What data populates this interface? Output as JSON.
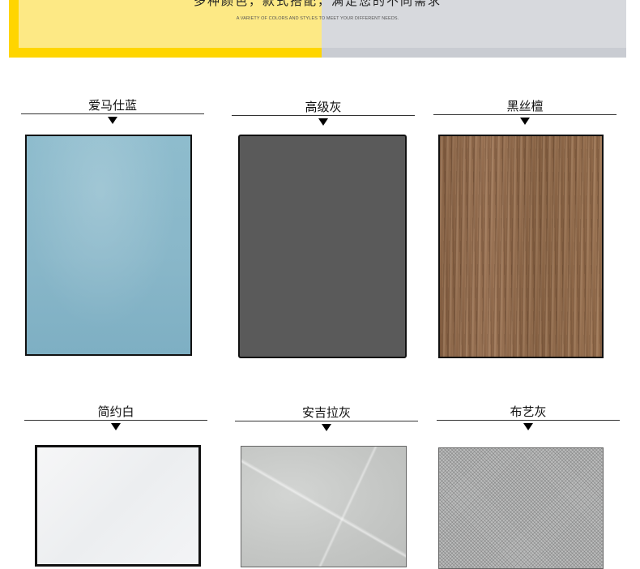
{
  "banner": {
    "headline": "多种颜色，款式搭配，满足您的不同需求",
    "subtitle": "A VARIETY OF COLORS AND STYLES TO MEET YOUR DIFFERENT NEEDS."
  },
  "swatches": [
    {
      "label": "爱马仕蓝",
      "color": "#8ebccd"
    },
    {
      "label": "高级灰",
      "color": "#5a5a5a"
    },
    {
      "label": "黑丝檀",
      "color": "#8f6a4b"
    },
    {
      "label": "简约白",
      "color": "#f2f3f5"
    },
    {
      "label": "安吉拉灰",
      "color": "#c6c8c6"
    },
    {
      "label": "布艺灰",
      "color": "#b5b6b6"
    }
  ],
  "colors": {
    "accent_yellow": "#ffd500",
    "banner_grey": "#c9ccd2"
  }
}
